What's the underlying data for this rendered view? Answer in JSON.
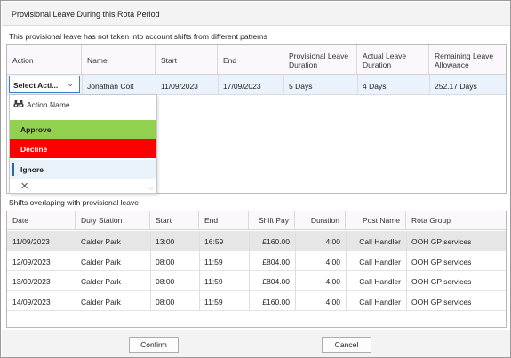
{
  "window": {
    "title": "Provisional Leave During this Rota Period"
  },
  "leave_section": {
    "caption": "This provisional leave has not taken into account shifts from different patterns",
    "columns": [
      "Action",
      "Name",
      "Start",
      "End",
      "Provisional Leave Duration",
      "Actual Leave Duration",
      "Remaining Leave Allowance"
    ],
    "row": {
      "action": "Select Acti...",
      "name": "Jonathan Colt",
      "start": "11/09/2023",
      "end": "17/09/2023",
      "provisional": "5 Days",
      "actual": "4 Days",
      "remaining": "252.17 Days"
    }
  },
  "action_dropdown": {
    "header": "Action Name",
    "header_icon": "binoculars-icon",
    "items": [
      {
        "label": "Approve",
        "color": "#92d050"
      },
      {
        "label": "Decline",
        "color": "#ff0000"
      },
      {
        "label": "Ignore",
        "color": "#ebf3fa"
      }
    ],
    "clear_icon": "close-icon",
    "resize_icon": "resize-grip-icon"
  },
  "shifts_section": {
    "caption": "Shifts overlaping with provisional leave",
    "columns": [
      "Date",
      "Duty Station",
      "Start",
      "End",
      "Shift Pay",
      "Duration",
      "Post Name",
      "Rota Group"
    ],
    "rows": [
      {
        "date": "11/09/2023",
        "station": "Calder Park",
        "start": "13:00",
        "end": "16:59",
        "pay": "£160.00",
        "duration": "4:00",
        "post": "Call Handler",
        "group": "OOH GP services"
      },
      {
        "date": "12/09/2023",
        "station": "Calder Park",
        "start": "08:00",
        "end": "11:59",
        "pay": "£804.00",
        "duration": "4:00",
        "post": "Call Handler",
        "group": "OOH GP services"
      },
      {
        "date": "13/09/2023",
        "station": "Calder Park",
        "start": "08:00",
        "end": "11:59",
        "pay": "£804.00",
        "duration": "4:00",
        "post": "Call Handler",
        "group": "OOH GP services"
      },
      {
        "date": "14/09/2023",
        "station": "Calder Park",
        "start": "08:00",
        "end": "11:59",
        "pay": "£160.00",
        "duration": "4:00",
        "post": "Call Handler",
        "group": "OOH GP services"
      }
    ]
  },
  "buttons": {
    "confirm": "Confirm",
    "cancel": "Cancel"
  }
}
